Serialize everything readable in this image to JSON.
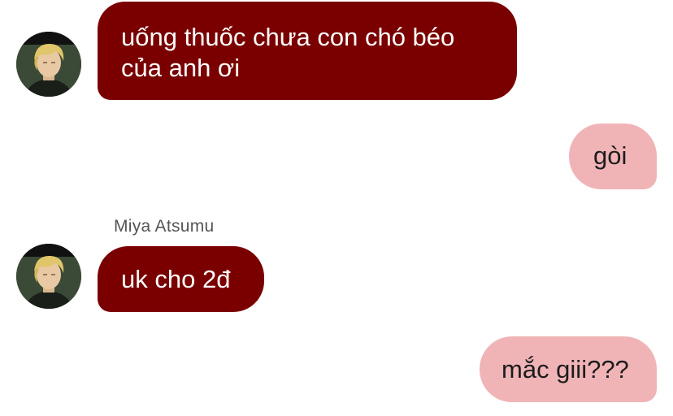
{
  "conversation": {
    "messages": [
      {
        "direction": "incoming",
        "sender_name": "",
        "text": "uống thuốc chưa con chó béo\ncủa anh ơi",
        "avatar_icon": "person-avatar-icon"
      },
      {
        "direction": "outgoing",
        "text": "gòi"
      },
      {
        "direction": "incoming",
        "sender_name": "Miya Atsumu",
        "text": "uk cho 2đ",
        "avatar_icon": "person-avatar-icon"
      },
      {
        "direction": "outgoing",
        "text": "mắc giii???"
      }
    ]
  },
  "colors": {
    "incoming_bubble": "#7a0000",
    "incoming_text": "#ffffff",
    "outgoing_bubble": "#f0b4b7",
    "outgoing_text": "#1c1c1c",
    "sender_name": "#555555"
  }
}
